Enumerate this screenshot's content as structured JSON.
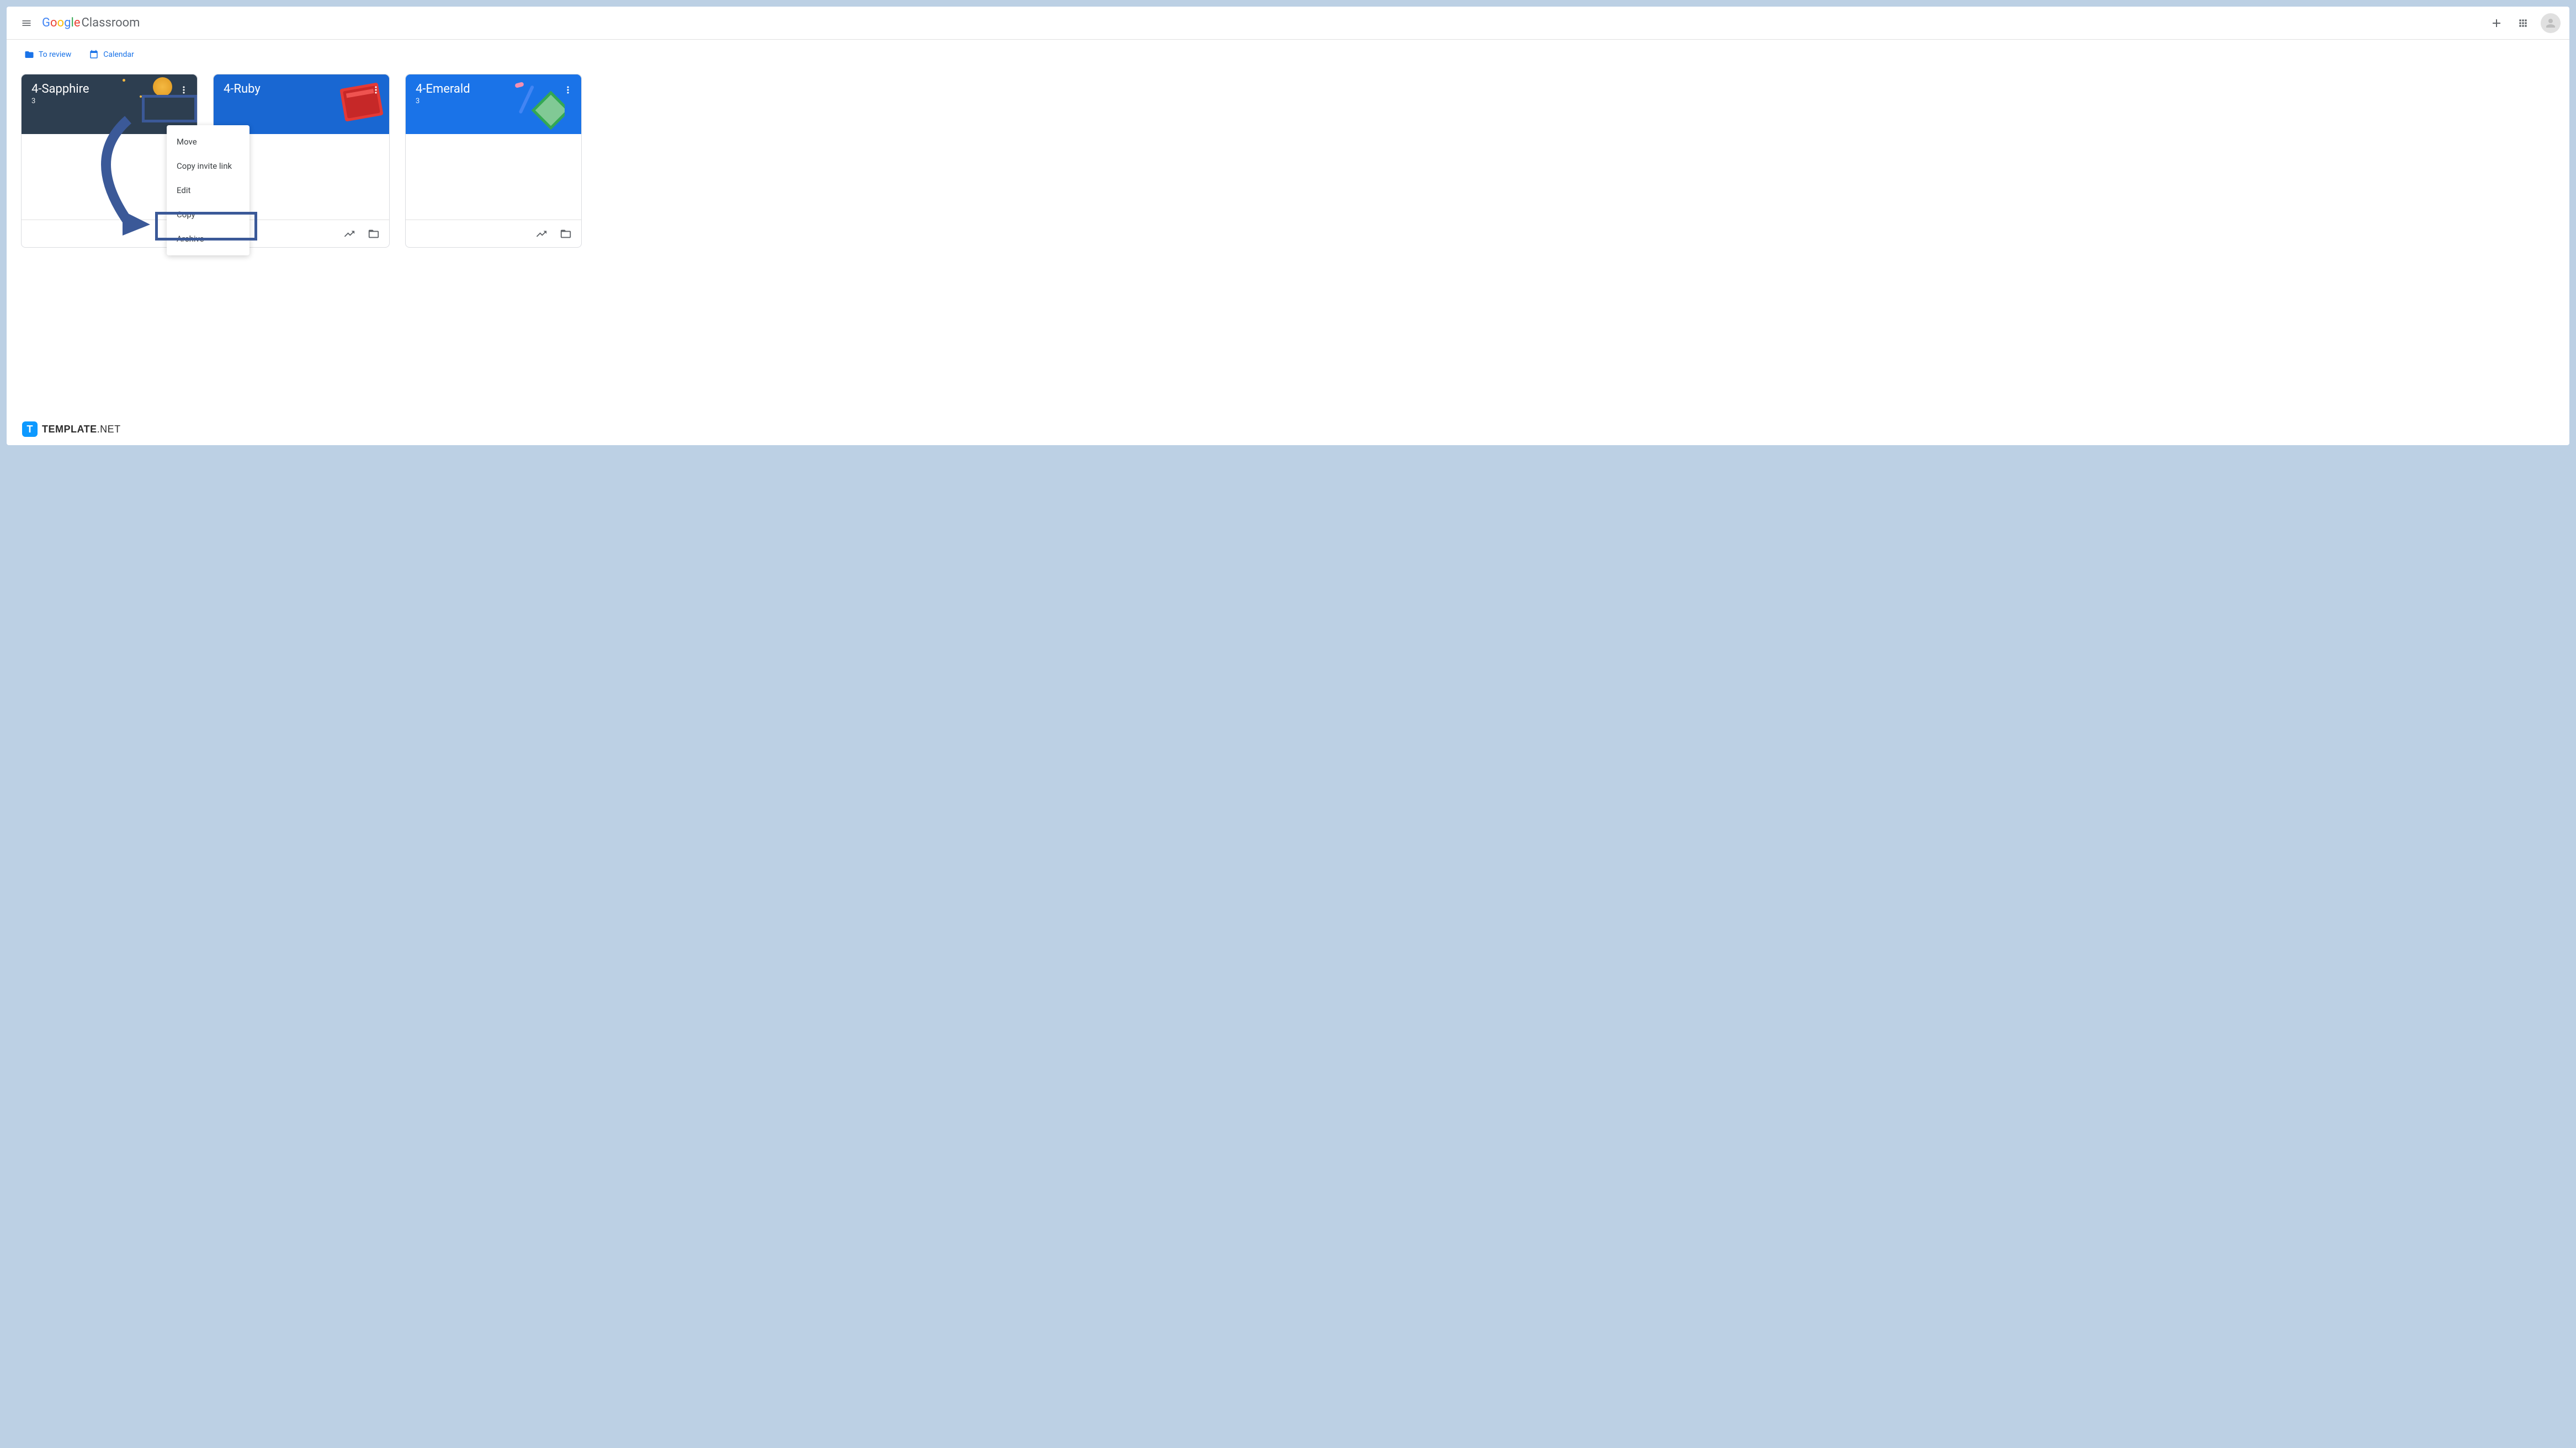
{
  "header": {
    "logo_text": "Classroom"
  },
  "subheader": {
    "to_review": "To review",
    "calendar": "Calendar"
  },
  "cards": [
    {
      "title": "4-Sapphire",
      "subtitle": "3"
    },
    {
      "title": "4-Ruby",
      "subtitle": ""
    },
    {
      "title": "4-Emerald",
      "subtitle": "3"
    }
  ],
  "menu": {
    "move": "Move",
    "copy_invite": "Copy invite link",
    "edit": "Edit",
    "copy": "Copy",
    "archive": "Archive"
  },
  "watermark": {
    "brand": "TEMPLATE",
    "suffix": ".NET"
  }
}
